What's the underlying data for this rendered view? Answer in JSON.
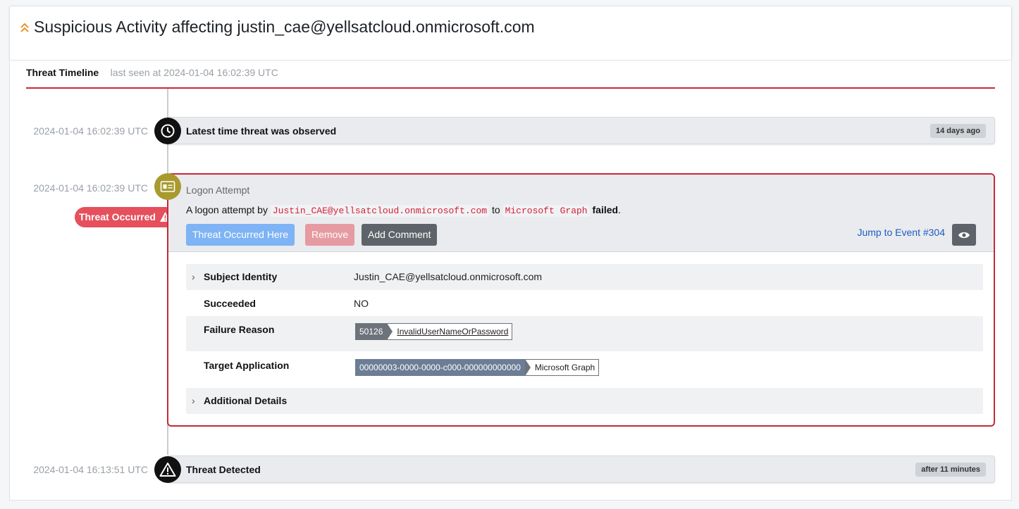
{
  "header": {
    "title": "Suspicious Activity affecting justin_cae@yellsatcloud.onmicrosoft.com",
    "accent_color": "#e8952a"
  },
  "timeline": {
    "title": "Threat Timeline",
    "subtitle": "last seen at 2024-01-04 16:02:39 UTC",
    "rule_color": "#c52a36"
  },
  "entries": {
    "latest": {
      "timestamp": "2024-01-04 16:02:39 UTC",
      "label": "Latest time threat was observed",
      "badge": "14 days ago",
      "icon": "clock-icon"
    },
    "event": {
      "timestamp": "2024-01-04 16:02:39 UTC",
      "icon": "id-card-icon",
      "threat_badge": "Threat Occurred",
      "type": "Logon Attempt",
      "desc_prefix": "A logon attempt by",
      "desc_user": "Justin_CAE@yellsatcloud.onmicrosoft.com",
      "desc_mid": "to",
      "desc_app": "Microsoft Graph",
      "desc_result": "failed",
      "desc_end": ".",
      "buttons": {
        "threat_here": "Threat Occurred Here",
        "remove": "Remove",
        "add_comment": "Add Comment"
      },
      "jump_link": "Jump to Event #304",
      "details": {
        "subject_identity": {
          "key": "Subject Identity",
          "value": "Justin_CAE@yellsatcloud.onmicrosoft.com"
        },
        "succeeded": {
          "key": "Succeeded",
          "value": "NO"
        },
        "failure_reason": {
          "key": "Failure Reason",
          "code": "50126",
          "text": "InvalidUserNameOrPassword"
        },
        "target_application": {
          "key": "Target Application",
          "id": "00000003-0000-0000-c000-000000000000",
          "name": "Microsoft Graph"
        },
        "additional": {
          "key": "Additional Details"
        }
      }
    },
    "detected": {
      "timestamp": "2024-01-04 16:13:51 UTC",
      "label": "Threat Detected",
      "badge": "after 11 minutes",
      "icon": "warning-icon"
    }
  }
}
